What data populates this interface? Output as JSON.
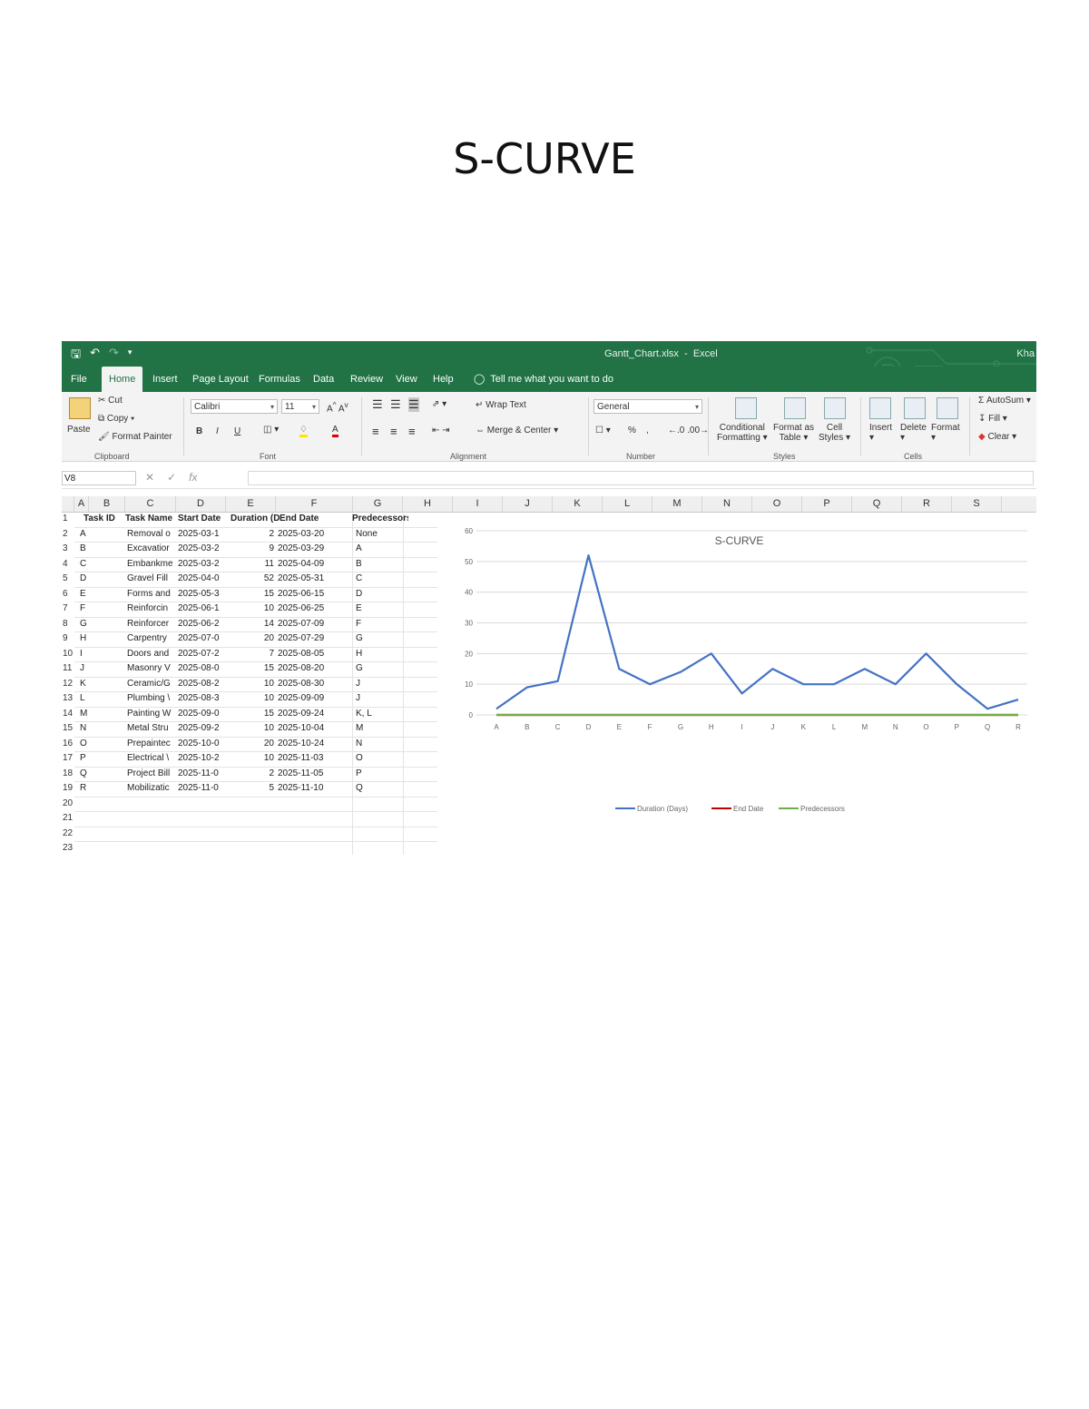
{
  "page_title": "S-CURVE",
  "window": {
    "filename": "Gantt_Chart.xlsx",
    "app": "Excel",
    "user": "Kha"
  },
  "menu": [
    "File",
    "Home",
    "Insert",
    "Page Layout",
    "Formulas",
    "Data",
    "Review",
    "View",
    "Help"
  ],
  "menu_active": "Home",
  "tell_me": "Tell me what you want to do",
  "ribbon": {
    "clipboard": {
      "paste": "Paste",
      "cut": "Cut",
      "copy": "Copy",
      "format_painter": "Format Painter",
      "label": "Clipboard"
    },
    "font": {
      "name": "Calibri",
      "size": "11",
      "label": "Font",
      "bold": "B",
      "italic": "I",
      "underline": "U"
    },
    "alignment": {
      "wrap": "Wrap Text",
      "merge": "Merge & Center",
      "label": "Alignment"
    },
    "number": {
      "format": "General",
      "percent": "%",
      "label": "Number"
    },
    "styles": {
      "conditional": "Conditional",
      "conditional2": "Formatting",
      "format_as": "Format as",
      "format_as2": "Table",
      "cell": "Cell",
      "cell2": "Styles",
      "label": "Styles"
    },
    "cells": {
      "insert": "Insert",
      "delete": "Delete",
      "format": "Format",
      "label": "Cells"
    },
    "editing": {
      "autosum": "AutoSum",
      "fill": "Fill",
      "clear": "Clear"
    }
  },
  "formula_bar": {
    "name_box": "V8",
    "fx": "fx"
  },
  "columns": [
    "A",
    "B",
    "C",
    "D",
    "E",
    "F",
    "G",
    "H",
    "I",
    "J",
    "K",
    "L",
    "M",
    "N",
    "O",
    "P",
    "Q",
    "R",
    "S"
  ],
  "headers": [
    "Task ID",
    "Task Name",
    "Start Date",
    "Duration (Da",
    "End Date",
    "Predecessors"
  ],
  "rows": [
    {
      "id": "A",
      "name": "Removal o",
      "start": "2025-03-1",
      "dur": "2",
      "end": "2025-03-20",
      "pred": "None"
    },
    {
      "id": "B",
      "name": "Excavatior",
      "start": "2025-03-2",
      "dur": "9",
      "end": "2025-03-29",
      "pred": "A"
    },
    {
      "id": "C",
      "name": "Embankme",
      "start": "2025-03-2",
      "dur": "11",
      "end": "2025-04-09",
      "pred": "B"
    },
    {
      "id": "D",
      "name": "Gravel Fill",
      "start": "2025-04-0",
      "dur": "52",
      "end": "2025-05-31",
      "pred": "C"
    },
    {
      "id": "E",
      "name": "Forms and",
      "start": "2025-05-3",
      "dur": "15",
      "end": "2025-06-15",
      "pred": "D"
    },
    {
      "id": "F",
      "name": "Reinforcin",
      "start": "2025-06-1",
      "dur": "10",
      "end": "2025-06-25",
      "pred": "E"
    },
    {
      "id": "G",
      "name": "Reinforcer",
      "start": "2025-06-2",
      "dur": "14",
      "end": "2025-07-09",
      "pred": "F"
    },
    {
      "id": "H",
      "name": "Carpentry",
      "start": "2025-07-0",
      "dur": "20",
      "end": "2025-07-29",
      "pred": "G"
    },
    {
      "id": "I",
      "name": "Doors and",
      "start": "2025-07-2",
      "dur": "7",
      "end": "2025-08-05",
      "pred": "H"
    },
    {
      "id": "J",
      "name": "Masonry V",
      "start": "2025-08-0",
      "dur": "15",
      "end": "2025-08-20",
      "pred": "G"
    },
    {
      "id": "K",
      "name": "Ceramic/G",
      "start": "2025-08-2",
      "dur": "10",
      "end": "2025-08-30",
      "pred": "J"
    },
    {
      "id": "L",
      "name": "Plumbing \\",
      "start": "2025-08-3",
      "dur": "10",
      "end": "2025-09-09",
      "pred": "J"
    },
    {
      "id": "M",
      "name": "Painting W",
      "start": "2025-09-0",
      "dur": "15",
      "end": "2025-09-24",
      "pred": "K, L"
    },
    {
      "id": "N",
      "name": "Metal Stru",
      "start": "2025-09-2",
      "dur": "10",
      "end": "2025-10-04",
      "pred": "M"
    },
    {
      "id": "O",
      "name": "Prepaintec",
      "start": "2025-10-0",
      "dur": "20",
      "end": "2025-10-24",
      "pred": "N"
    },
    {
      "id": "P",
      "name": "Electrical \\",
      "start": "2025-10-2",
      "dur": "10",
      "end": "2025-11-03",
      "pred": "O"
    },
    {
      "id": "Q",
      "name": "Project Bill",
      "start": "2025-11-0",
      "dur": "2",
      "end": "2025-11-05",
      "pred": "P"
    },
    {
      "id": "R",
      "name": "Mobilizatic",
      "start": "2025-11-0",
      "dur": "5",
      "end": "2025-11-10",
      "pred": "Q"
    }
  ],
  "row_numbers": [
    "1",
    "2",
    "3",
    "4",
    "5",
    "6",
    "7",
    "8",
    "9",
    "10",
    "11",
    "12",
    "13",
    "14",
    "15",
    "16",
    "17",
    "18",
    "19",
    "20",
    "21",
    "22",
    "23"
  ],
  "colors": {
    "excel_green": "#217346",
    "duration": "#4472c4",
    "end_date": "#c00000",
    "predecessors": "#70ad47"
  },
  "chart_data": {
    "type": "line",
    "title": "S-CURVE",
    "categories": [
      "A",
      "B",
      "C",
      "D",
      "E",
      "F",
      "G",
      "H",
      "I",
      "J",
      "K",
      "L",
      "M",
      "N",
      "O",
      "P",
      "Q",
      "R"
    ],
    "series": [
      {
        "name": "Duration (Days)",
        "values": [
          2,
          9,
          11,
          52,
          15,
          10,
          14,
          20,
          7,
          15,
          10,
          10,
          15,
          10,
          20,
          10,
          2,
          5
        ]
      },
      {
        "name": "End Date",
        "values": [
          0,
          0,
          0,
          0,
          0,
          0,
          0,
          0,
          0,
          0,
          0,
          0,
          0,
          0,
          0,
          0,
          0,
          0
        ]
      },
      {
        "name": "Predecessors",
        "values": [
          0,
          0,
          0,
          0,
          0,
          0,
          0,
          0,
          0,
          0,
          0,
          0,
          0,
          0,
          0,
          0,
          0,
          0
        ]
      }
    ],
    "yticks": [
      "0",
      "10",
      "20",
      "30",
      "40",
      "50",
      "60"
    ],
    "ylim": [
      0,
      60
    ],
    "legend_position": "bottom",
    "grid": true
  }
}
